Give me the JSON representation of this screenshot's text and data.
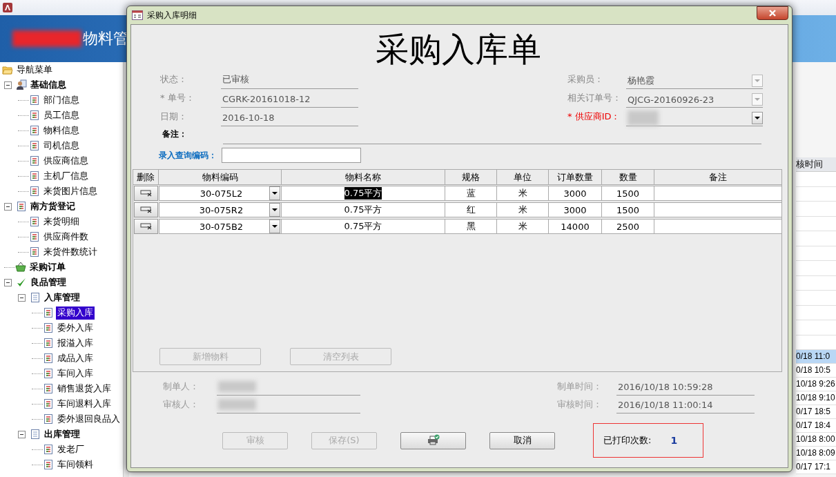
{
  "app": {
    "banner_title": "物料管"
  },
  "nav": {
    "title": "导航菜单",
    "items": [
      {
        "label": "基础信息",
        "kind": "person",
        "expanded": true,
        "selected": false,
        "children": [
          {
            "label": "部门信息",
            "kind": "doc",
            "selected": false
          },
          {
            "label": "员工信息",
            "kind": "doc",
            "selected": false
          },
          {
            "label": "物料信息",
            "kind": "doc",
            "selected": false
          },
          {
            "label": "司机信息",
            "kind": "doc",
            "selected": false
          },
          {
            "label": "供应商信息",
            "kind": "doc",
            "selected": false
          },
          {
            "label": "主机厂信息",
            "kind": "doc",
            "selected": false
          },
          {
            "label": "来货图片信息",
            "kind": "doc",
            "selected": false
          }
        ]
      },
      {
        "label": "南方货登记",
        "kind": "doc",
        "expanded": true,
        "selected": false,
        "children": [
          {
            "label": "来货明细",
            "kind": "doc",
            "selected": false
          },
          {
            "label": "供应商件数",
            "kind": "doc",
            "selected": false
          },
          {
            "label": "来货件数统计",
            "kind": "doc",
            "selected": false
          }
        ]
      },
      {
        "label": "采购订单",
        "kind": "basket",
        "selected": false
      },
      {
        "label": "良品管理",
        "kind": "check",
        "expanded": true,
        "selected": false,
        "children": [
          {
            "label": "入库管理",
            "kind": "page",
            "expanded": true,
            "selected": false,
            "children": [
              {
                "label": "采购入库",
                "kind": "doc",
                "selected": true
              },
              {
                "label": "委外入库",
                "kind": "doc",
                "selected": false
              },
              {
                "label": "报溢入库",
                "kind": "doc",
                "selected": false
              },
              {
                "label": "成品入库",
                "kind": "doc",
                "selected": false
              },
              {
                "label": "车间入库",
                "kind": "doc",
                "selected": false
              },
              {
                "label": "销售退货入库",
                "kind": "doc",
                "selected": false
              },
              {
                "label": "车间退料入库",
                "kind": "doc",
                "selected": false
              },
              {
                "label": "委外退回良品入",
                "kind": "doc",
                "selected": false
              }
            ]
          },
          {
            "label": "出库管理",
            "kind": "page",
            "expanded": true,
            "selected": false,
            "children": [
              {
                "label": "发老厂",
                "kind": "doc",
                "selected": false
              },
              {
                "label": "车间领料",
                "kind": "doc",
                "selected": false
              }
            ]
          }
        ]
      }
    ]
  },
  "background_table": {
    "column_header": "核时间",
    "rows": [
      {
        "value": "0/18 11:0",
        "selected": true
      },
      {
        "value": "0/18 10:5",
        "selected": false
      },
      {
        "value": "10/18 9:26",
        "selected": false
      },
      {
        "value": "10/18 9:10",
        "selected": false
      },
      {
        "value": "0/17 18:5",
        "selected": false
      },
      {
        "value": "0/17 18:4",
        "selected": false
      },
      {
        "value": "10/18 8:00",
        "selected": false
      },
      {
        "value": "10/18 8:09",
        "selected": false
      },
      {
        "value": "0/17 17:1",
        "selected": false
      }
    ]
  },
  "dialog": {
    "title": "采购入库明细",
    "heading": "采购入库单",
    "left_fields": [
      {
        "label": "状态：",
        "value": "已审核",
        "disabled": true
      },
      {
        "label": "* 单号：",
        "value": "CGRK-20161018-12",
        "disabled": true
      },
      {
        "label": "日期：",
        "value": "2016-10-18",
        "disabled": true
      }
    ],
    "right_fields": [
      {
        "label": "采购员：",
        "value": "杨艳霞",
        "disabled": true
      },
      {
        "label": "相关订单号：",
        "value": "QJCG-20160926-23",
        "disabled": true
      },
      {
        "label": "* 供应商ID：",
        "disabled": false
      }
    ],
    "remark_label": "备注：",
    "search_label": "录入查询编码：",
    "grid": {
      "columns": [
        "删除",
        "物料编码",
        "物料名称",
        "规格",
        "单位",
        "订单数量",
        "数量",
        "备注"
      ],
      "rows": [
        {
          "code": "30-075L2",
          "name": "0.75平方",
          "spec": "蓝",
          "unit": "米",
          "order_qty": "3000",
          "qty": "1500",
          "selected": true
        },
        {
          "code": "30-075R2",
          "name": "0.75平方",
          "spec": "红",
          "unit": "米",
          "order_qty": "3000",
          "qty": "1500",
          "selected": false
        },
        {
          "code": "30-075B2",
          "name": "0.75平方",
          "spec": "黑",
          "unit": "米",
          "order_qty": "14000",
          "qty": "2500",
          "selected": false
        }
      ],
      "buttons": [
        {
          "label": "新增物料",
          "disabled": true
        },
        {
          "label": "清空列表",
          "disabled": true
        }
      ]
    },
    "footer_left": [
      {
        "label": "制单人："
      },
      {
        "label": "审核人："
      }
    ],
    "footer_right": [
      {
        "label": "制单时间：",
        "value": "2016/10/18 10:59:28"
      },
      {
        "label": "审核时间：",
        "value": "2016/10/18 11:00:14"
      }
    ],
    "actions": [
      {
        "kind": "text",
        "label": "审核",
        "disabled": true
      },
      {
        "kind": "text",
        "label": "保存(S)",
        "disabled": true
      },
      {
        "kind": "print",
        "disabled": false
      },
      {
        "kind": "text",
        "label": "取消",
        "disabled": false
      }
    ],
    "print_count": {
      "label": "已打印次数:",
      "value": "1"
    }
  }
}
